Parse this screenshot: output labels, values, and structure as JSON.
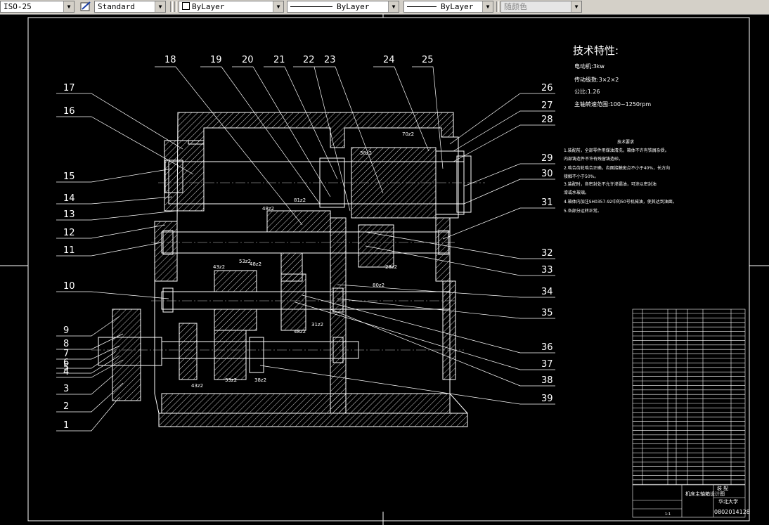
{
  "toolbar": {
    "text_style": "ISO-25",
    "dim_style": "Standard",
    "layer": "ByLayer",
    "linetype": "ByLayer",
    "lineweight": "ByLayer",
    "plot_color": "随颜色"
  },
  "callouts_left": [
    "17",
    "16",
    "15",
    "14",
    "13",
    "12",
    "11",
    "10",
    "9",
    "8",
    "7",
    "6",
    "5",
    "4",
    "3",
    "2",
    "1"
  ],
  "callouts_top": [
    "18",
    "19",
    "20",
    "21",
    "22",
    "23",
    "24",
    "25"
  ],
  "callouts_right": [
    "26",
    "27",
    "28",
    "29",
    "30",
    "31",
    "32",
    "33",
    "34",
    "35",
    "36",
    "37",
    "38",
    "39"
  ],
  "spec": {
    "heading": "技术特性:",
    "lines": [
      "电动机:3kw",
      "传动级数:3×2×2",
      "公比:1.26",
      "主轴转速范围:100~1250rpm"
    ]
  },
  "requirements": {
    "heading": "技术要求",
    "lines": [
      "1.装配前，全部零件用煤油清洗，箱体不许有铁屑杂质。",
      "  内部铸造件不许有残留铸造砂。",
      "2.啮合齿轮啮合正确，齿面接触斑点不小于40%，长方向",
      "  接触不小于50%。",
      "3.装配时，各密封处不允许渗漏油，可涂以密封油",
      "  漆或水玻璃。",
      "4.箱体内加注SH0357-92中的50号机械油，使其达到油面。",
      "5.各部分运转正常。"
    ]
  },
  "dimensions": [
    "70z2",
    "38z2",
    "81z2",
    "48z2",
    "43z2",
    "53z2",
    "48z2",
    "28z2",
    "80z2",
    "31z2",
    "43z2",
    "33z2",
    "38z2",
    "48z2"
  ],
  "title_block": {
    "title": "机床主轴箱设计图",
    "school": "华北大学",
    "drawing_no": "0802014128",
    "material": "装 配",
    "scale_row": "1:1"
  },
  "colors": {
    "background": "#000000",
    "drawing": "#ffffff",
    "center_line": "#c8c8c8",
    "toolbar": "#d4d0c8"
  }
}
